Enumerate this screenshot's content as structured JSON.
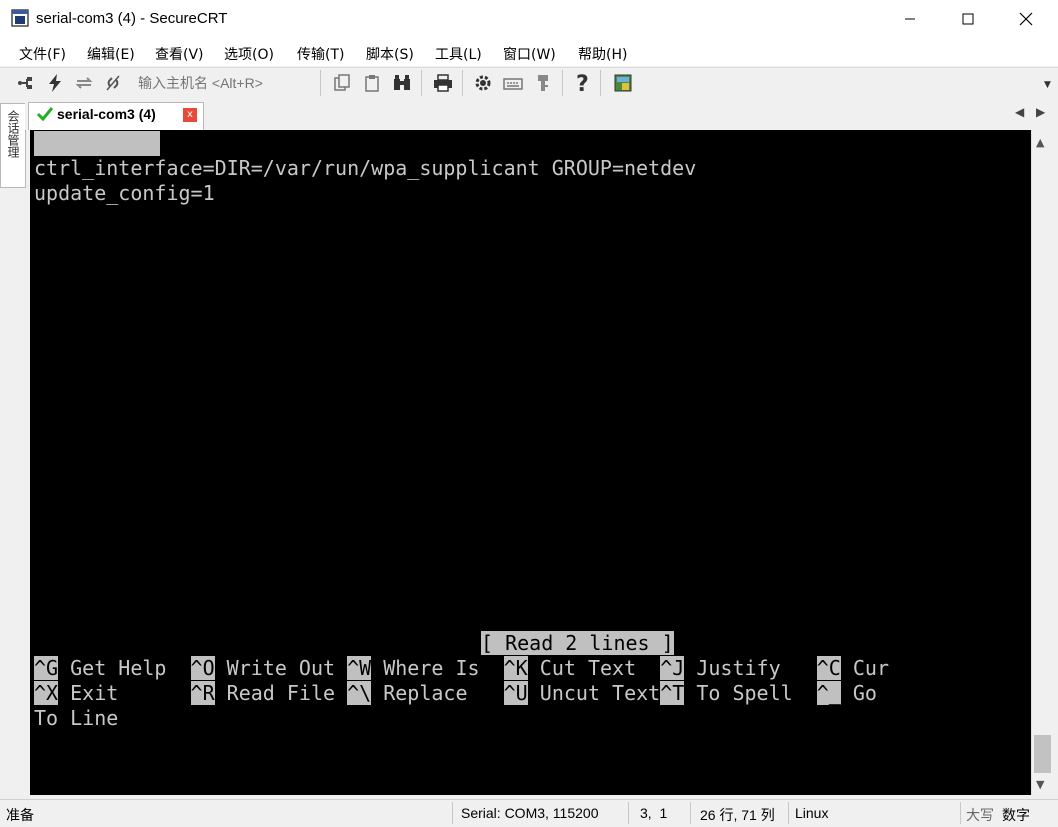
{
  "window": {
    "title": "serial-com3 (4) - SecureCRT",
    "minimize": "—",
    "maximize": "☐",
    "close": "✕"
  },
  "menu": [
    "文件(F)",
    "编辑(E)",
    "查看(V)",
    "选项(O)",
    "传输(T)",
    "脚本(S)",
    "工具(L)",
    "窗口(W)",
    "帮助(H)"
  ],
  "toolbar": {
    "host_placeholder": "输入主机名 <Alt+R>",
    "icons": [
      "connect-tree-icon",
      "lightning-icon",
      "reconnect-icon",
      "disconnect-icon",
      "copy-icon",
      "paste-icon",
      "find-icon",
      "print-icon",
      "settings-gear-icon",
      "keymap-icon",
      "key-icon",
      "help-icon",
      "sftp-icon"
    ]
  },
  "side_panel": {
    "label": "会话管理"
  },
  "tab": {
    "label": "serial-com3 (4)",
    "close": "x"
  },
  "terminal": {
    "lines": [
      "ctrl_interface=DIR=/var/run/wpa_supplicant GROUP=netdev",
      "update_config=1"
    ],
    "status_message": "[ Read 2 lines ]",
    "shortcuts_row1": [
      {
        "key": "^G",
        "label": " Get Help  "
      },
      {
        "key": "^O",
        "label": " Write Out "
      },
      {
        "key": "^W",
        "label": " Where Is  "
      },
      {
        "key": "^K",
        "label": " Cut Text  "
      },
      {
        "key": "^J",
        "label": " Justify   "
      },
      {
        "key": "^C",
        "label": " Cur"
      }
    ],
    "shortcuts_row2": [
      {
        "key": "^X",
        "label": " Exit      "
      },
      {
        "key": "^R",
        "label": " Read File "
      },
      {
        "key": "^\\",
        "label": " Replace   "
      },
      {
        "key": "^U",
        "label": " Uncut Text"
      },
      {
        "key": "^T",
        "label": " To Spell  "
      },
      {
        "key": "^_",
        "label": " Go"
      }
    ],
    "wrap_line": "To Line"
  },
  "statusbar": {
    "ready": "准备",
    "connection": "Serial: COM3, 115200",
    "cursor": "3,  1",
    "size": "26 行, 71 列",
    "terminal_type": "Linux",
    "caps": "大写",
    "num": "数字"
  }
}
